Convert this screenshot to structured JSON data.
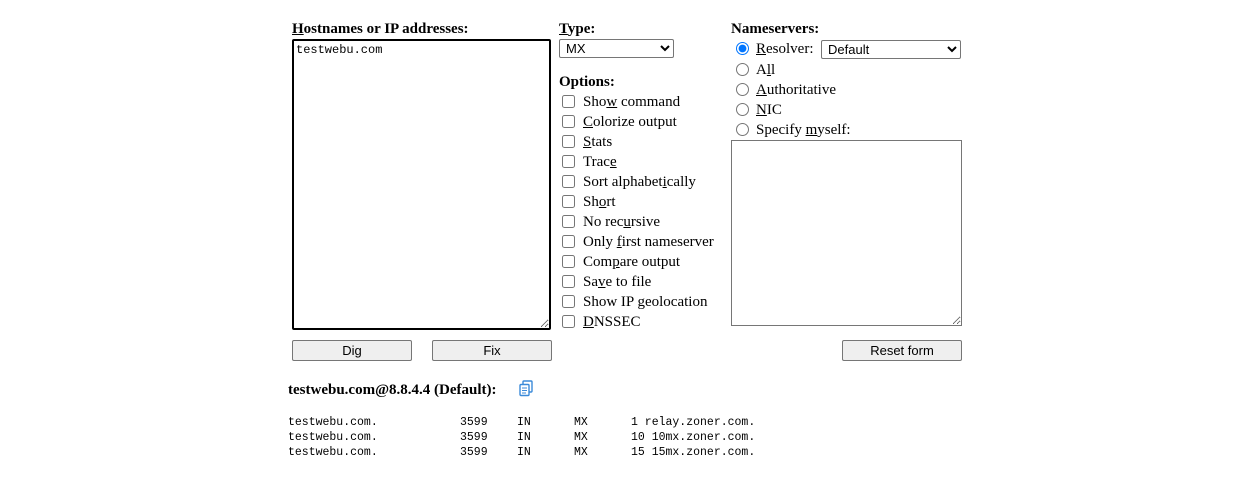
{
  "hosts": {
    "label_first": "H",
    "label_rest": "ostnames or IP addresses:",
    "value": "testwebu.com"
  },
  "type": {
    "label_first": "T",
    "label_rest": "ype:",
    "selected": "MX"
  },
  "options": {
    "heading": "Options:",
    "items": [
      {
        "pre": "Sho",
        "u": "w",
        "post": " command",
        "checked": false
      },
      {
        "pre": "",
        "u": "C",
        "post": "olorize output",
        "checked": false
      },
      {
        "pre": "",
        "u": "S",
        "post": "tats",
        "checked": false
      },
      {
        "pre": "Trac",
        "u": "e",
        "post": "",
        "checked": false
      },
      {
        "pre": "Sort alphabet",
        "u": "i",
        "post": "cally",
        "checked": false
      },
      {
        "pre": "Sh",
        "u": "o",
        "post": "rt",
        "checked": false
      },
      {
        "pre": "No rec",
        "u": "u",
        "post": "rsive",
        "checked": false
      },
      {
        "pre": "Only ",
        "u": "f",
        "post": "irst nameserver",
        "checked": false
      },
      {
        "pre": "Com",
        "u": "p",
        "post": "are output",
        "checked": false
      },
      {
        "pre": "Sa",
        "u": "v",
        "post": "e to file",
        "checked": false
      },
      {
        "pre": "Show IP ",
        "u": "g",
        "post": "eolocation",
        "checked": false
      },
      {
        "pre": "",
        "u": "D",
        "post": "NSSEC",
        "checked": false
      }
    ]
  },
  "nameservers": {
    "heading": "Nameservers:",
    "resolver": {
      "pre": "",
      "u": "R",
      "post": "esolver:",
      "selected": "Default",
      "checked": true
    },
    "all": {
      "pre": "A",
      "u": "l",
      "post": "l",
      "checked": false
    },
    "authoritative": {
      "pre": "",
      "u": "A",
      "post": "uthoritative",
      "checked": false
    },
    "nic": {
      "pre": "",
      "u": "N",
      "post": "IC",
      "checked": false
    },
    "specify": {
      "pre": "Specify ",
      "u": "m",
      "post": "yself:",
      "checked": false
    },
    "custom_value": ""
  },
  "buttons": {
    "dig": "Dig",
    "fix": "Fix",
    "reset": "Reset form"
  },
  "result": {
    "title": "testwebu.com@8.8.4.4 (Default):",
    "records": [
      {
        "name": "testwebu.com.",
        "ttl": "3599",
        "class": "IN",
        "type": "MX",
        "data": "1 relay.zoner.com."
      },
      {
        "name": "testwebu.com.",
        "ttl": "3599",
        "class": "IN",
        "type": "MX",
        "data": "10 10mx.zoner.com."
      },
      {
        "name": "testwebu.com.",
        "ttl": "3599",
        "class": "IN",
        "type": "MX",
        "data": "15 15mx.zoner.com."
      }
    ]
  },
  "icons": {
    "copy": "copy-icon",
    "accent": "#3b8ad9"
  }
}
